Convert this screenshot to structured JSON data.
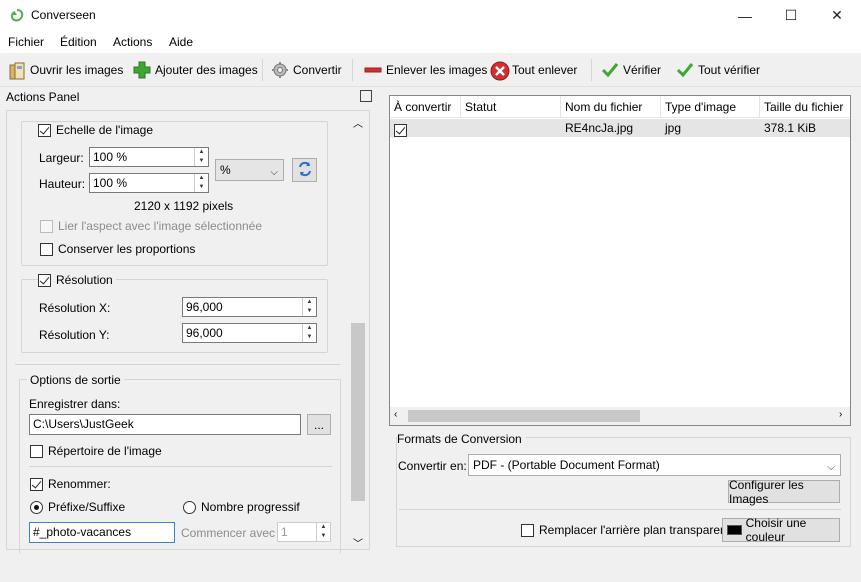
{
  "window": {
    "title": "Converseen",
    "minimize": "—",
    "maximize": "☐",
    "close": "✕"
  },
  "menu": {
    "items": [
      {
        "label": "Fichier"
      },
      {
        "label": "Édition"
      },
      {
        "label": "Actions"
      },
      {
        "label": "Aide"
      }
    ]
  },
  "toolbar": {
    "open_images": "Ouvrir les images",
    "add_images": "Ajouter des images",
    "convert": "Convertir",
    "remove_images": "Enlever les images",
    "remove_all": "Tout enlever",
    "check": "Vérifier",
    "check_all": "Tout vérifier"
  },
  "actions_panel": {
    "title": "Actions Panel",
    "scale": {
      "label": "Echelle de l'image",
      "checked": true,
      "width_label": "Largeur:",
      "width_value": "100 %",
      "height_label": "Hauteur:",
      "height_value": "100 %",
      "unit_value": "%",
      "pixels": "2120 x 1192 pixels",
      "link_aspect_label": "Lier l'aspect avec l'image sélectionnée",
      "keep_proportions_label": "Conserver les proportions"
    },
    "resolution": {
      "label": "Résolution",
      "checked": true,
      "x_label": "Résolution X:",
      "x_value": "96,000",
      "y_label": "Résolution Y:",
      "y_value": "96,000"
    },
    "output": {
      "label": "Options de sortie",
      "save_in_label": "Enregistrer dans:",
      "save_in_value": "C:\\Users\\JustGeek",
      "browse_label": "...",
      "image_dir_label": "Répertoire de l'image",
      "rename_label": "Renommer:",
      "prefix_suffix_label": "Préfixe/Suffixe",
      "progressive_label": "Nombre progressif",
      "rename_value": "#_photo-vacances",
      "start_with_label": "Commencer avec :",
      "start_with_value": "1"
    }
  },
  "files_table": {
    "columns": [
      "À convertir",
      "Statut",
      "Nom du fichier",
      "Type d'image",
      "Taille du fichier"
    ],
    "rows": [
      {
        "to_convert": true,
        "status": "",
        "name": "RE4ncJa.jpg",
        "type": "jpg",
        "size": "378.1 KiB"
      }
    ]
  },
  "formats": {
    "label": "Formats de Conversion",
    "convert_to_label": "Convertir en:",
    "convert_to_value": "PDF - (Portable Document Format)",
    "configure_label": "Configurer les Images",
    "replace_bg_label": "Remplacer l'arrière plan transparent",
    "choose_color_label": "Choisir une couleur",
    "bg_color": "#000000"
  }
}
